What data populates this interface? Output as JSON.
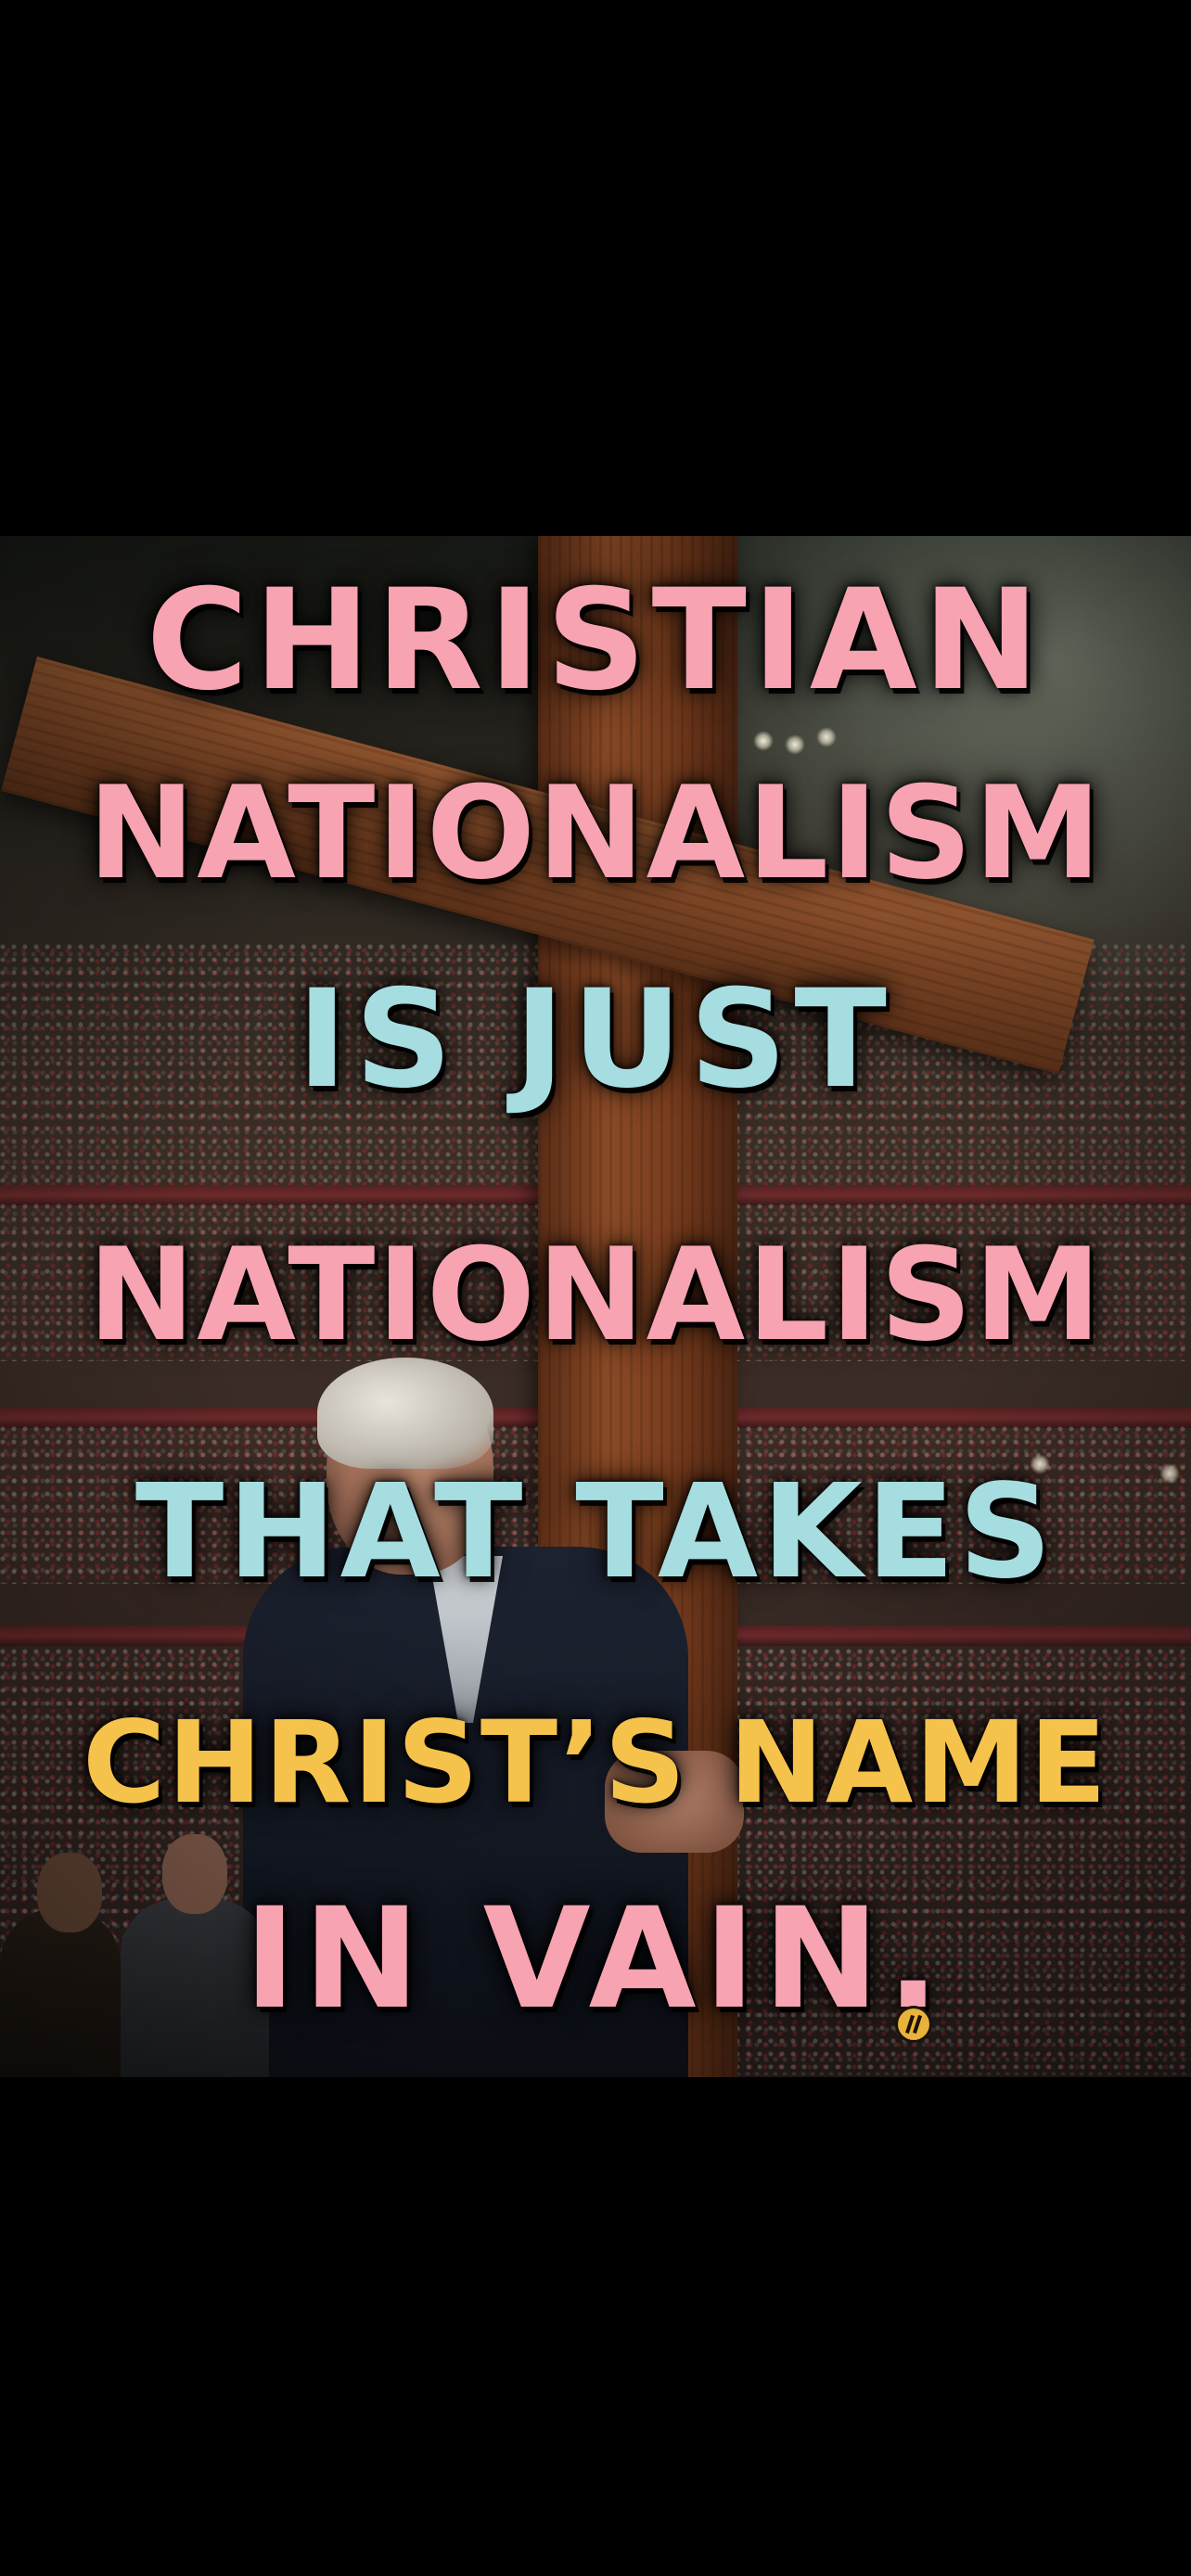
{
  "poster": {
    "lines": [
      {
        "text": "CHRISTIAN",
        "color": "#f7a3b1"
      },
      {
        "text": "NATIONALISM",
        "color": "#f7a3b1"
      },
      {
        "text": "IS JUST",
        "color": "#a6dde0"
      },
      {
        "text": "NATIONALISM",
        "color": "#f7a3b1"
      },
      {
        "text": "THAT TAKES",
        "color": "#a6dde0"
      },
      {
        "text": "CHRIST’S NAME",
        "color": "#f5c24c"
      },
      {
        "text": "IN VAIN.",
        "color": "#f7a3b1"
      }
    ],
    "signature_mark": "artist-signature-logo"
  },
  "colors": {
    "background": "#000000",
    "pink": "#f7a3b1",
    "cyan": "#a6dde0",
    "yellow": "#f5c24c"
  }
}
